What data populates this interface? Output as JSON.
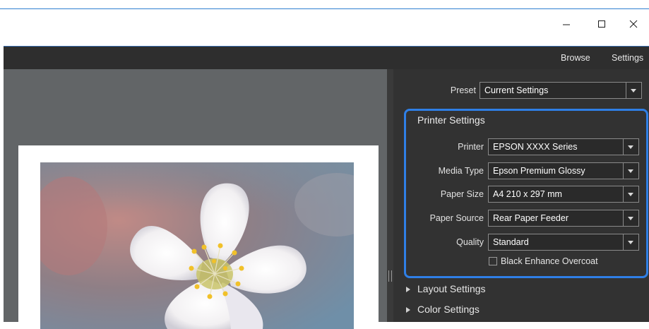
{
  "window": {
    "minimize_label": "–",
    "maximize_label": "☐",
    "close_label": "✕"
  },
  "menubar": {
    "browse": "Browse",
    "settings": "Settings"
  },
  "preset": {
    "label": "Preset",
    "value": "Current Settings"
  },
  "printer_settings": {
    "title": "Printer Settings",
    "fields": [
      {
        "label": "Printer",
        "value": "EPSON XXXX Series"
      },
      {
        "label": "Media Type",
        "value": "Epson Premium Glossy"
      },
      {
        "label": "Paper Size",
        "value": "A4 210 x 297 mm"
      },
      {
        "label": "Paper Source",
        "value": "Rear Paper Feeder"
      },
      {
        "label": "Quality",
        "value": "Standard"
      }
    ],
    "black_enhance_label": "Black Enhance Overcoat",
    "black_enhance_checked": false
  },
  "sections": [
    {
      "label": "Layout Settings"
    },
    {
      "label": "Color Settings"
    }
  ],
  "colors": {
    "accent": "#2f7fe6",
    "panel": "#323232",
    "preview_bg": "#626567"
  },
  "icons": [
    "minimize-icon",
    "maximize-icon",
    "close-icon",
    "dropdown-arrow-icon",
    "expand-triangle-icon",
    "splitter-grip-icon"
  ]
}
